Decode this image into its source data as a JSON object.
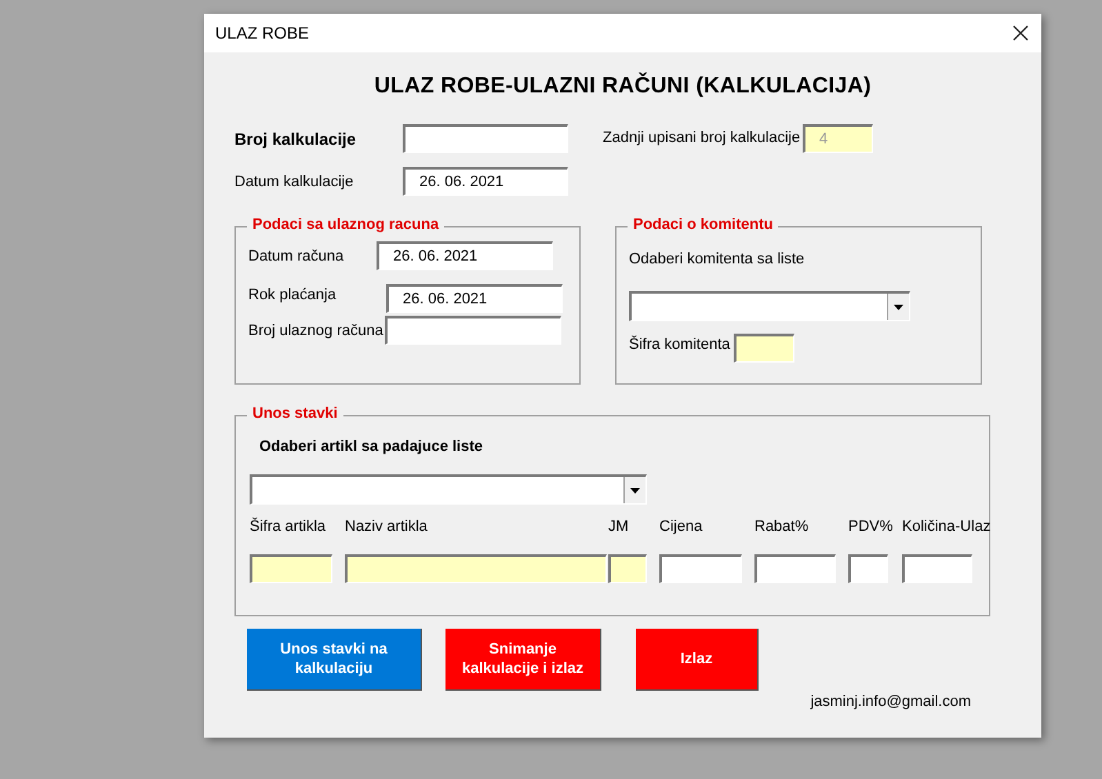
{
  "window": {
    "title": "ULAZ ROBE"
  },
  "heading": "ULAZ ROBE-ULAZNI RAČUNI  (KALKULACIJA)",
  "calculation": {
    "number": {
      "label": "Broj kalkulacije"
    },
    "date": {
      "label": "Datum kalkulacije",
      "value": "26. 06. 2021"
    },
    "last_number": {
      "label": "Zadnji upisani broj kalkulacije",
      "value": "4",
      "locked": true
    }
  },
  "invoice_frame": {
    "title": "Podaci sa ulaznog racuna",
    "fields": [
      {
        "label": "Datum računa",
        "value": "26. 06. 2021"
      },
      {
        "label": "Rok  plaćanja",
        "value": "26. 06. 2021"
      },
      {
        "label": "Broj ulaznog računa"
      }
    ]
  },
  "client_frame": {
    "title": "Podaci o komitentu",
    "prompt": "Odaberi komitenta sa liste",
    "code_field": {
      "label": "Šifra komitenta",
      "locked": true
    }
  },
  "items_frame": {
    "title": "Unos stavki",
    "prompt": "Odaberi artikl sa padajuce  liste",
    "columns": [
      {
        "label": "Šifra artikla",
        "locked": true
      },
      {
        "label": "Naziv artikla",
        "locked": true
      },
      {
        "label": "JM",
        "locked": true
      },
      {
        "label": "Cijena",
        "locked": false
      },
      {
        "label": "Rabat%",
        "locked": false
      },
      {
        "label": "PDV%",
        "locked": false
      },
      {
        "label": "Količina-Ulaz",
        "locked": false
      }
    ]
  },
  "buttons": [
    {
      "label": "Unos stavki na kalkulaciju",
      "color": "#0078d7"
    },
    {
      "label": "Snimanje kalkulacije i izlaz",
      "color": "#ff0000"
    },
    {
      "label": "Izlaz",
      "color": "#ff0000"
    }
  ],
  "footer_email": "jasminj.info@gmail.com"
}
